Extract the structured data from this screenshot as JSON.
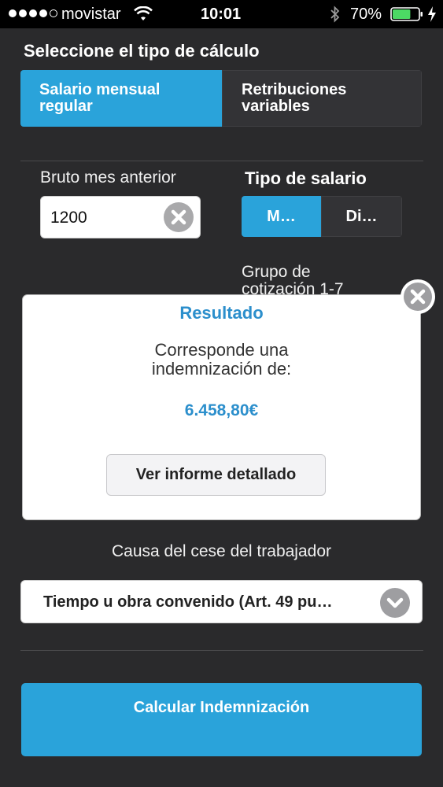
{
  "status_bar": {
    "carrier": "movistar",
    "time": "10:01",
    "battery": "70%",
    "battery_level": 0.7,
    "signal_bars_filled": 4,
    "signal_bars_total": 5
  },
  "calc_type": {
    "title": "Seleccione el tipo de cálculo",
    "options": [
      {
        "label_line1": "Salario mensual",
        "label_line2": "regular",
        "selected": true
      },
      {
        "label_line1": "Retribuciones",
        "label_line2": "variables",
        "selected": false
      }
    ]
  },
  "gross": {
    "label": "Bruto mes anterior",
    "value": "1200"
  },
  "salary_type": {
    "label": "Tipo de salario",
    "options": [
      {
        "label": "M…",
        "selected": true
      },
      {
        "label": "Di…",
        "selected": false
      }
    ]
  },
  "group": {
    "label_line1": "Grupo de",
    "label_line2": "cotización 1-7"
  },
  "dialog": {
    "title": "Resultado",
    "message_line1": "Corresponde una",
    "message_line2": "indemnización de:",
    "amount": "6.458,80€",
    "button_label": "Ver informe detallado"
  },
  "cause": {
    "label": "Causa del cese del trabajador",
    "selected": "Tiempo u obra convenido (Art. 49 pu…"
  },
  "calculate_button": "Calcular Indemnización",
  "colors": {
    "accent": "#2aa3da",
    "background": "#2a2a2c",
    "dialog_title": "#2c8fcc",
    "battery": "#4cd964"
  }
}
